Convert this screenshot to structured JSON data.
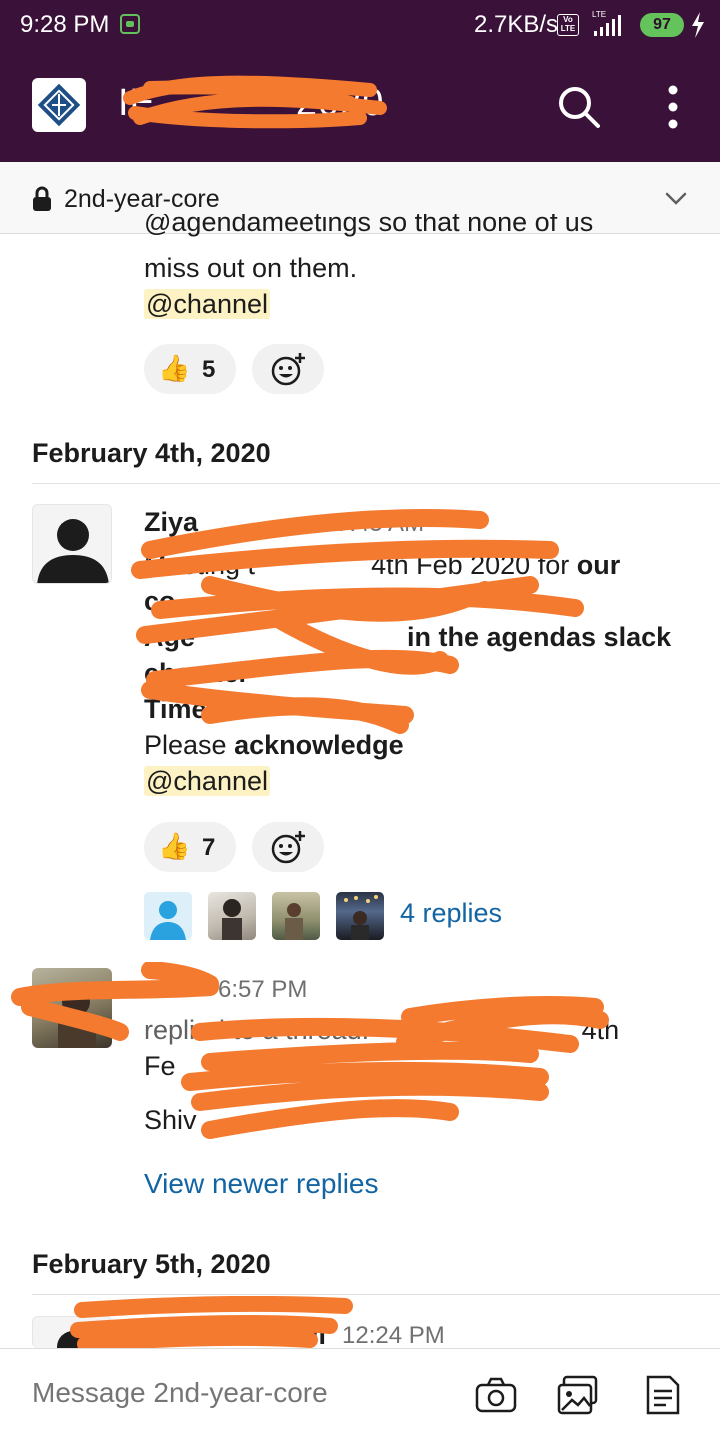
{
  "status_bar": {
    "time": "9:28 PM",
    "net_speed": "2.7KB/s",
    "volte": "Vo LTE",
    "lte": "LTE",
    "battery": "97"
  },
  "header": {
    "workspace_title": "IE",
    "title_suffix": "2020",
    "search_icon": "search-icon",
    "more_icon": "more-vertical-icon"
  },
  "channel": {
    "name": "2nd-year-core",
    "lock_icon": "lock-icon",
    "dropdown_icon": "chevron-down-icon"
  },
  "messages": {
    "first": {
      "line_partial": "@agendameetings so that none of us",
      "line2": "miss out on them.",
      "mention": "@channel",
      "reaction_emoji": "👍",
      "reaction_count": "5"
    },
    "date1": "February 4th, 2020",
    "second": {
      "sender": "Ziya",
      "time": "7:45 AM",
      "line1_a": "Meeting t",
      "line1_b": "4th Feb 2020 for ",
      "line1_c": "our",
      "line2": "co",
      "line3_a": "Age",
      "line3_b": "in the agendas slack",
      "line4": "channel",
      "line5": "Time:",
      "line6_a": "Please ",
      "line6_b": "acknowledge",
      "mention": "@channel",
      "reaction_emoji": "👍",
      "reaction_count": "7",
      "replies": "4 replies"
    },
    "third": {
      "sender": "",
      "time": "6:57 PM",
      "line1_a": "replied to a thread: ",
      "line1_b": "4th",
      "line2": "Fe",
      "line3": "Shiv",
      "newer_replies": "View newer replies"
    },
    "date2": "February 5th, 2020",
    "fourth": {
      "sender_suffix": "ali",
      "time": "12:24 PM"
    }
  },
  "composer": {
    "placeholder": "Message 2nd-year-core",
    "camera_icon": "camera-icon",
    "gallery_icon": "gallery-icon",
    "file_icon": "file-icon"
  },
  "colors": {
    "header_bg": "#3a1138",
    "link": "#1264a3",
    "mention_bg": "#fdf2c3",
    "redaction": "#f47a30"
  }
}
